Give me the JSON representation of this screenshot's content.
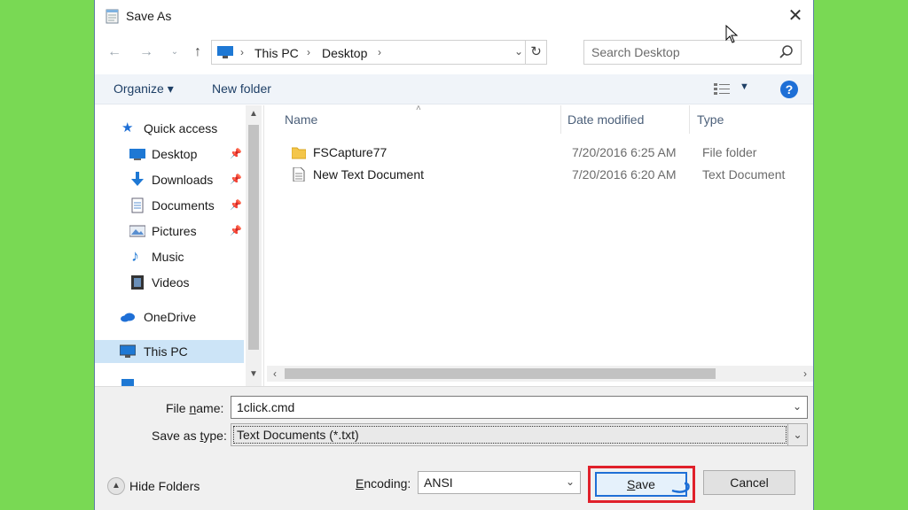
{
  "window": {
    "title": "Save As"
  },
  "nav": {
    "back_icon": "back-arrow-icon",
    "forward_icon": "forward-arrow-icon",
    "up_icon": "up-arrow-icon",
    "breadcrumb": [
      "This PC",
      "Desktop"
    ],
    "search_placeholder": "Search Desktop"
  },
  "toolbar": {
    "organize": "Organize ▾",
    "new_folder": "New folder"
  },
  "sidebar": {
    "items": [
      {
        "label": "Quick access",
        "icon": "star-icon",
        "pinned": false
      },
      {
        "label": "Desktop",
        "icon": "desktop-icon",
        "pinned": true
      },
      {
        "label": "Downloads",
        "icon": "download-icon",
        "pinned": true
      },
      {
        "label": "Documents",
        "icon": "documents-icon",
        "pinned": true
      },
      {
        "label": "Pictures",
        "icon": "pictures-icon",
        "pinned": true
      },
      {
        "label": "Music",
        "icon": "music-icon",
        "pinned": false
      },
      {
        "label": "Videos",
        "icon": "videos-icon",
        "pinned": false
      },
      {
        "label": "OneDrive",
        "icon": "cloud-icon",
        "pinned": false
      },
      {
        "label": "This PC",
        "icon": "computer-icon",
        "pinned": false,
        "selected": true
      }
    ]
  },
  "filelist": {
    "columns": [
      "Name",
      "Date modified",
      "Type"
    ],
    "rows": [
      {
        "name": "FSCapture77",
        "date": "7/20/2016 6:25 AM",
        "type": "File folder",
        "icon": "folder-icon"
      },
      {
        "name": "New Text Document",
        "date": "7/20/2016 6:20 AM",
        "type": "Text Document",
        "icon": "text-file-icon"
      }
    ]
  },
  "form": {
    "file_name_label_pre": "File ",
    "file_name_label_u": "n",
    "file_name_label_post": "ame:",
    "file_name_value": "1click.cmd",
    "save_type_label_pre": "Save as ",
    "save_type_label_u": "t",
    "save_type_label_post": "ype:",
    "save_type_value": "Text Documents (*.txt)",
    "hide_folders": "Hide Folders",
    "encoding_label_u": "E",
    "encoding_label_post": "ncoding:",
    "encoding_value": "ANSI",
    "save_button_u": "S",
    "save_button_post": "ave",
    "cancel_button": "Cancel"
  },
  "colors": {
    "background": "#79d954",
    "highlight": "#e0202a",
    "accent": "#1e6fd6"
  }
}
